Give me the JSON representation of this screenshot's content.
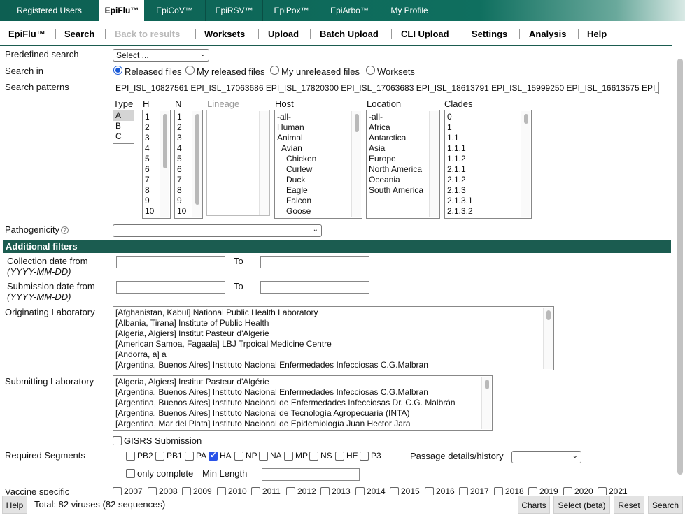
{
  "top_tabs": [
    "Registered Users",
    "EpiFlu™",
    "EpiCoV™",
    "EpiRSV™",
    "EpiPox™",
    "EpiArbo™",
    "My Profile"
  ],
  "subnav": [
    "EpiFlu™",
    "Search",
    "Back to results",
    "Worksets",
    "Upload",
    "Batch Upload",
    "CLI Upload",
    "Settings",
    "Analysis",
    "Help"
  ],
  "form": {
    "predefined_search_label": "Predefined search",
    "predefined_search_value": "Select ...",
    "search_in_label": "Search in",
    "search_in_options": [
      "Released files",
      "My released files",
      "My unreleased files",
      "Worksets"
    ],
    "search_patterns_label": "Search patterns",
    "search_patterns_value": "EPI_ISL_10827561 EPI_ISL_17063686 EPI_ISL_17820300 EPI_ISL_17063683 EPI_ISL_18613791 EPI_ISL_15999250 EPI_ISL_16613575 EPI_IS",
    "pathogenicity_label": "Pathogenicity"
  },
  "columns": {
    "type": {
      "label": "Type",
      "items": [
        "A",
        "B",
        "C"
      ]
    },
    "h": {
      "label": "H",
      "items": [
        "1",
        "2",
        "3",
        "4",
        "5",
        "6",
        "7",
        "8",
        "9",
        "10"
      ]
    },
    "n": {
      "label": "N",
      "items": [
        "1",
        "2",
        "3",
        "4",
        "5",
        "6",
        "7",
        "8",
        "9",
        "10"
      ]
    },
    "lineage": {
      "label": "Lineage"
    },
    "host": {
      "label": "Host",
      "items": [
        "-all-",
        "Human",
        "Animal",
        "Avian",
        "Chicken",
        "Curlew",
        "Duck",
        "Eagle",
        "Falcon",
        "Goose"
      ]
    },
    "location": {
      "label": "Location",
      "items": [
        "-all-",
        "Africa",
        "Antarctica",
        "Asia",
        "Europe",
        "North America",
        "Oceania",
        "South America"
      ]
    },
    "clades": {
      "label": "Clades",
      "items": [
        "0",
        "1",
        "1.1",
        "1.1.1",
        "1.1.2",
        "2.1.1",
        "2.1.2",
        "2.1.3",
        "2.1.3.1",
        "2.1.3.2"
      ]
    }
  },
  "additional": {
    "header": "Additional filters",
    "collection_label": "Collection date from",
    "date_format": "(YYYY-MM-DD)",
    "to_label": "To",
    "submission_label": "Submission date from",
    "orig_lab_label": "Originating Laboratory",
    "orig_labs": [
      "[Afghanistan, Kabul] National Public Health Laboratory",
      "[Albania, Tirana] Institute of Public Health",
      "[Algeria, Algiers] Institut Pasteur d'Algerie",
      "[American Samoa, Fagaala] LBJ Trpoical Medicine Centre",
      "[Andorra, a] a",
      "[Argentina, Buenos Aires] Instituto Nacional Enfermedades Infecciosas C.G.Malbran"
    ],
    "sub_lab_label": "Submitting Laboratory",
    "sub_labs": [
      "[Algeria, Algiers] Institut Pasteur d'Algérie",
      "[Argentina, Buenos Aires] Instituto Nacional Enfermedades Infecciosas C.G.Malbran",
      "[Argentina, Buenos Aires] Instituto Nacional de Enfermedades Infecciosas Dr. C.G. Malbrán",
      "[Argentina, Buenos Aires] Instituto Nacional de Tecnología Agropecuaria (INTA)",
      "[Argentina, Mar del Plata] Instituto Nacional de Epidemiología Juan Hector Jara"
    ],
    "gisrs_label": "GISRS Submission",
    "required_segments_label": "Required Segments",
    "segments": [
      "PB2",
      "PB1",
      "PA",
      "HA",
      "NP",
      "NA",
      "MP",
      "NS",
      "HE",
      "P3"
    ],
    "passage_label": "Passage details/history",
    "only_complete_label": "only complete",
    "min_length_label": "Min Length",
    "vaccine_label": "Vaccine specific",
    "vaccine_years": [
      "2007",
      "2008",
      "2009",
      "2010",
      "2011",
      "2012",
      "2013",
      "2014",
      "2015",
      "2016",
      "2017",
      "2018",
      "2019",
      "2020",
      "2021"
    ]
  },
  "status": {
    "help": "Help",
    "total": "Total: 82 viruses (82 sequences)",
    "charts": "Charts",
    "select_beta": "Select (beta)",
    "reset": "Reset",
    "search": "Search"
  }
}
